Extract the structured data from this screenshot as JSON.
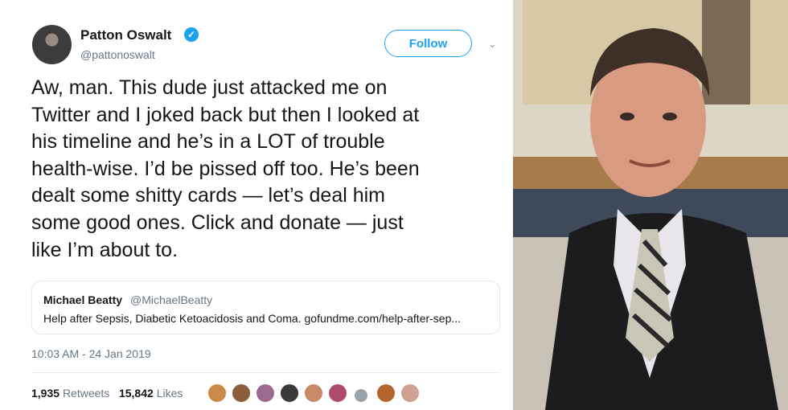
{
  "tweet": {
    "author_name": "Patton Oswalt",
    "author_handle": "@pattonoswalt",
    "follow_label": "Follow",
    "text_lines": [
      "Aw, man. This dude just attacked me on",
      "Twitter and I joked back but then I looked at",
      "his timeline and he’s in a LOT of trouble",
      "health-wise. I’d be pissed off too. He’s been",
      "dealt some shitty cards — let’s deal him",
      "some good ones. Click and donate — just",
      "like I’m about to."
    ],
    "quoted": {
      "name": "Michael Beatty",
      "handle": "@MichaelBeatty",
      "text": "Help after Sepsis, Diabetic Ketoacidosis and Coma. gofundme.com/help-after-sep..."
    },
    "timestamp": "10:03 AM - 24 Jan 2019",
    "retweets_count": "1,935",
    "retweets_label": "Retweets",
    "likes_count": "15,842",
    "likes_label": "Likes"
  },
  "colors": {
    "accent": "#1da1f2",
    "text": "#14171a",
    "muted": "#657786"
  }
}
